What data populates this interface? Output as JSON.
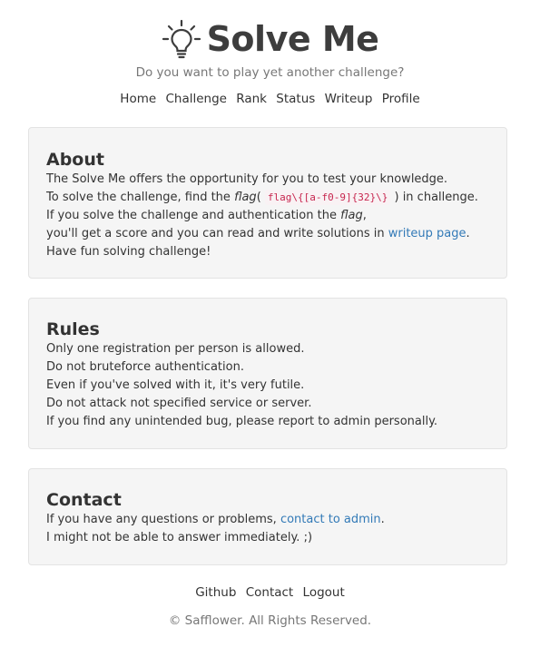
{
  "header": {
    "title": "Solve Me",
    "icon": "lightbulb-icon",
    "tagline": "Do you want to play yet another challenge?"
  },
  "nav": {
    "items": [
      "Home",
      "Challenge",
      "Rank",
      "Status",
      "Writeup",
      "Profile"
    ]
  },
  "about": {
    "heading": "About",
    "line1": "The Solve Me offers the opportunity for you to test your knowledge.",
    "line2_pre": "To solve the challenge, find the ",
    "line2_flag": "flag",
    "line2_open": "( ",
    "line2_code": "flag\\{[a-f0-9]{32}\\}",
    "line2_post": " ) in challenge.",
    "line3_pre": "If you solve the challenge and authentication the ",
    "line3_flag": "flag",
    "line3_post": ",",
    "line4_pre": "you'll get a score and you can read and write solutions in ",
    "line4_link": "writeup page",
    "line4_post": ".",
    "line5": "Have fun solving challenge!"
  },
  "rules": {
    "heading": "Rules",
    "lines": [
      "Only one registration per person is allowed.",
      "Do not bruteforce authentication.",
      "Even if you've solved with it, it's very futile.",
      "Do not attack not specified service or server.",
      "If you find any unintended bug, please report to admin personally."
    ]
  },
  "contact": {
    "heading": "Contact",
    "line1_pre": "If you have any questions or problems, ",
    "line1_link": "contact to admin",
    "line1_post": ".",
    "line2": "I might not be able to answer immediately. ;)"
  },
  "footer": {
    "links": [
      "Github",
      "Contact",
      "Logout"
    ],
    "copyright": "© Safflower. All Rights Reserved."
  },
  "colors": {
    "link": "#337ab7",
    "card_bg": "#f5f5f5",
    "code": "#c7254e"
  }
}
